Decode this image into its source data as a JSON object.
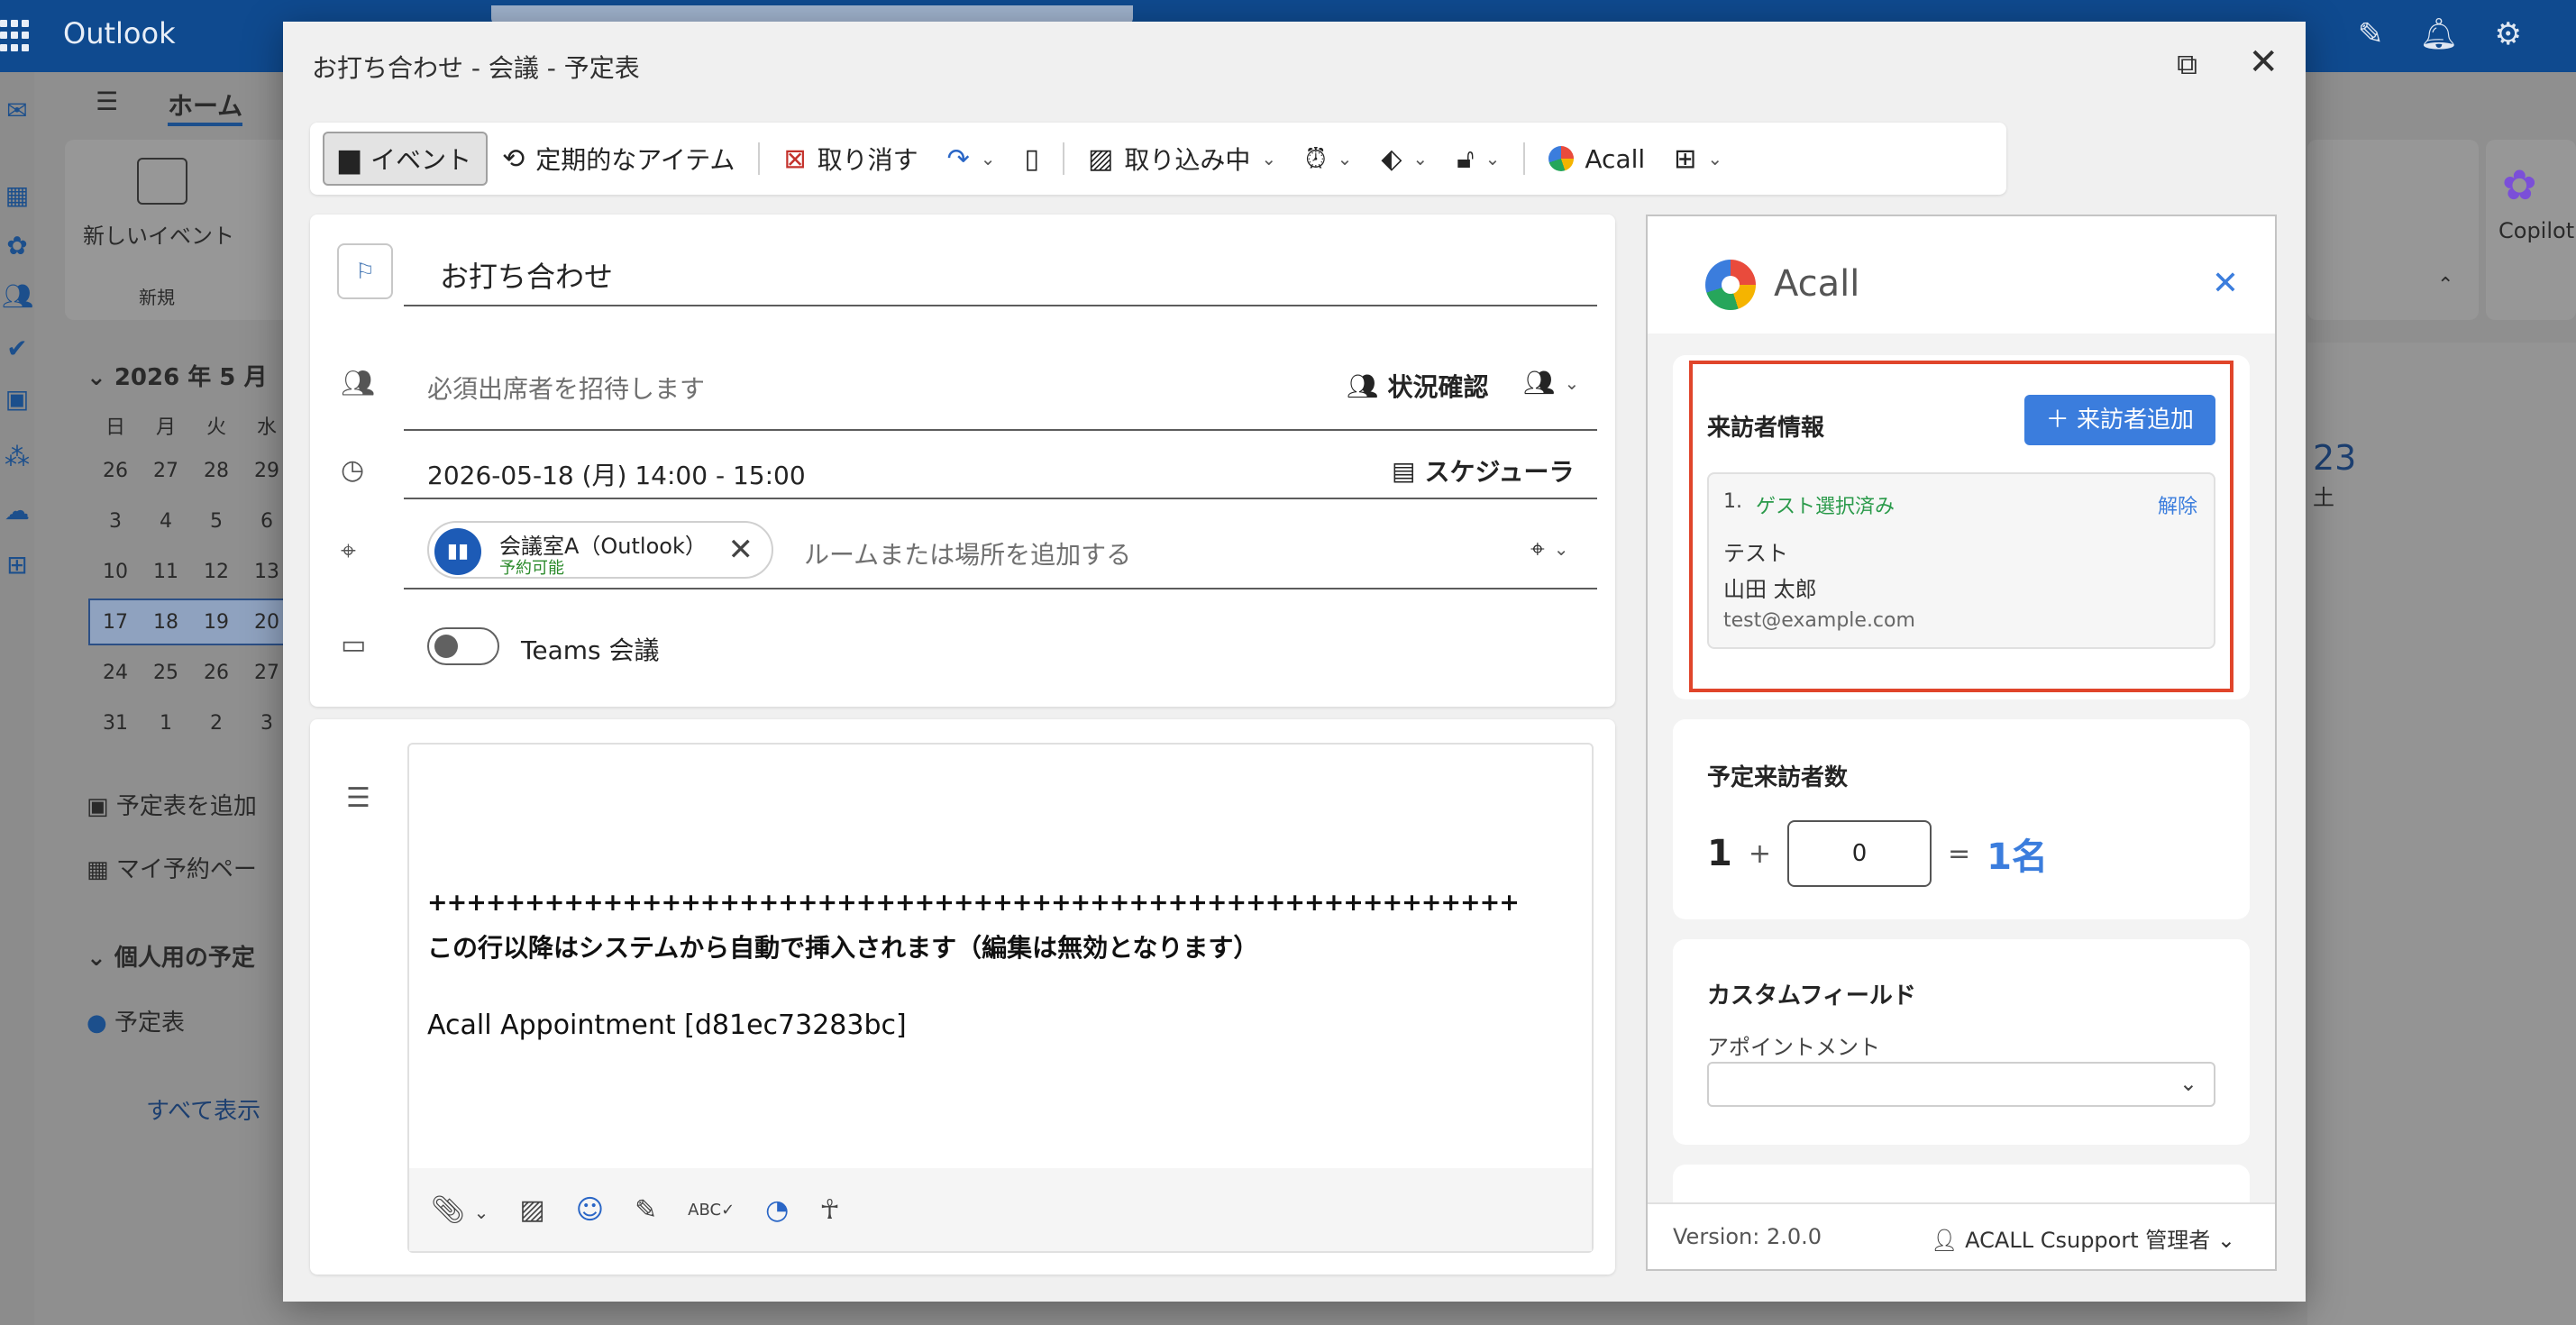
{
  "app": {
    "name": "Outlook"
  },
  "background": {
    "ribbon_tab": "ホーム",
    "new_event": "新しいイベント",
    "new_group": "新規",
    "copilot": "Copilot",
    "month": "2026 年 5 月",
    "weekdays": [
      "日",
      "月",
      "火",
      "水"
    ],
    "weeks": [
      [
        "26",
        "27",
        "28",
        "29"
      ],
      [
        "3",
        "4",
        "5",
        "6"
      ],
      [
        "10",
        "11",
        "12",
        "13"
      ],
      [
        "17",
        "18",
        "19",
        "20"
      ],
      [
        "24",
        "25",
        "26",
        "27"
      ],
      [
        "31",
        "1",
        "2",
        "3"
      ]
    ],
    "add_calendar": "予定表を追加",
    "my_booking": "マイ予約ペー",
    "personal": "個人用の予定",
    "calendar": "予定表",
    "show_all": "すべて表示",
    "right_day": "23",
    "right_dow": "土"
  },
  "dialog": {
    "title": "お打ち合わせ - 会議 - 予定表"
  },
  "toolbar": {
    "event": "イベント",
    "recurring": "定期的なアイテム",
    "cancel": "取り消す",
    "busy": "取り込み中",
    "acall": "Acall"
  },
  "form": {
    "title": "お打ち合わせ",
    "attendees_placeholder": "必須出席者を招待します",
    "status_check": "状況確認",
    "datetime": "2026-05-18 (月) 14:00 - 15:00",
    "scheduler": "スケジューラ",
    "room_name": "会議室A（Outlook）",
    "room_status": "予約可能",
    "location_placeholder": "ルームまたは場所を追加する",
    "teams": "Teams 会議"
  },
  "body": {
    "separator": "++++++++++++++++++++++++++++++++++++++++++++++++++++++++",
    "auto_notice": "この行以降はシステムから自動で挿入されます（編集は無効となります）",
    "appointment": "Acall Appointment [d81ec73283bc]"
  },
  "acall": {
    "name": "Acall",
    "visitor_info": "来訪者情報",
    "add_visitor": "＋ 来訪者追加",
    "guest": {
      "index": "1.",
      "status": "ゲスト選択済み",
      "unlink": "解除",
      "company": "テスト",
      "name": "山田 太郎",
      "email": "test@example.com"
    },
    "planned_count_title": "予定来訪者数",
    "count_base": "1",
    "count_plus": "+",
    "count_input": "0",
    "count_eq": "=",
    "count_total": "1名",
    "custom_field_title": "カスタムフィールド",
    "appointment_label": "アポイントメント",
    "version": "Version: 2.0.0",
    "user": "ACALL Csupport 管理者"
  },
  "colors": {
    "accent": "#3b7ddd",
    "topbar": "#0f4a8f",
    "highlight": "#e0452b",
    "success": "#2a9a4a"
  }
}
